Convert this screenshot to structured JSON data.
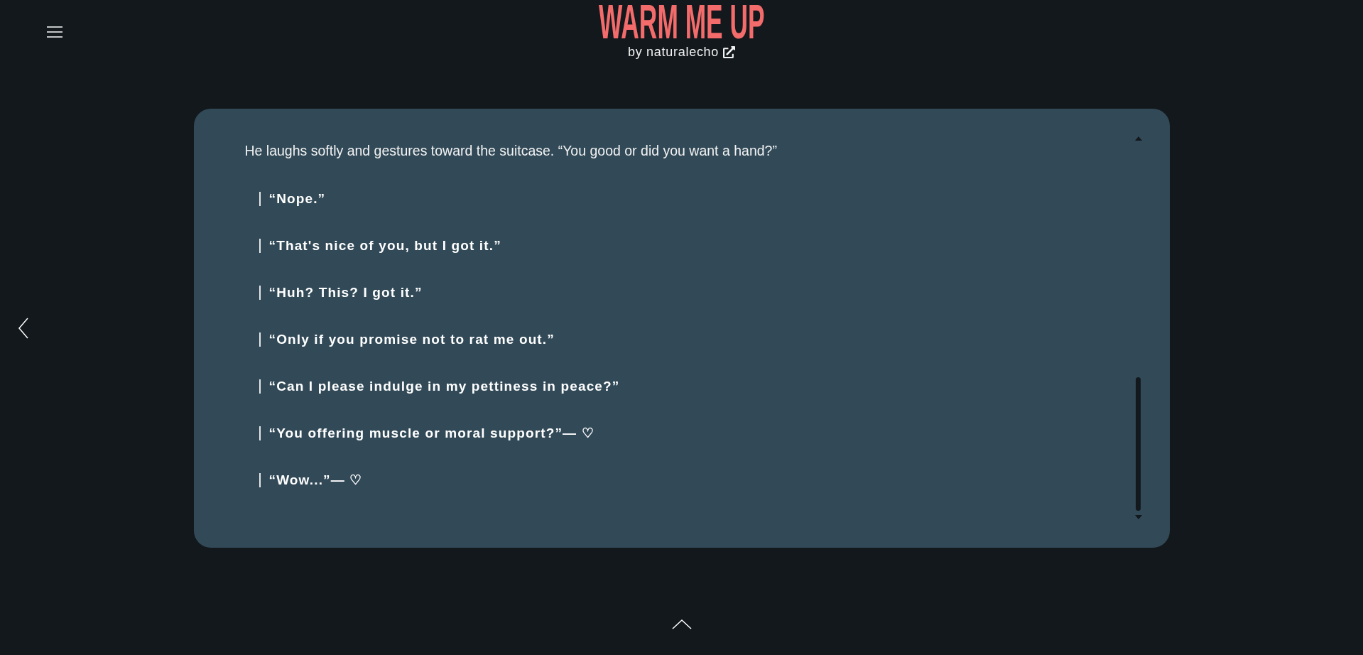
{
  "header": {
    "title": "WARM ME UP",
    "byline": "by naturalecho"
  },
  "passage": {
    "text": "He laughs softly and gestures toward the suitcase. “You good or did you want a hand?”",
    "choices": [
      "“Nope.”",
      "“That's nice of you, but I got it.”",
      "“Huh? This? I got it.”",
      "“Only if you promise not to rat me out.”",
      "“Can I please indulge in my pettiness in peace?”",
      "“You offering muscle or moral support?”— ♡",
      "“Wow...”— ♡"
    ]
  }
}
